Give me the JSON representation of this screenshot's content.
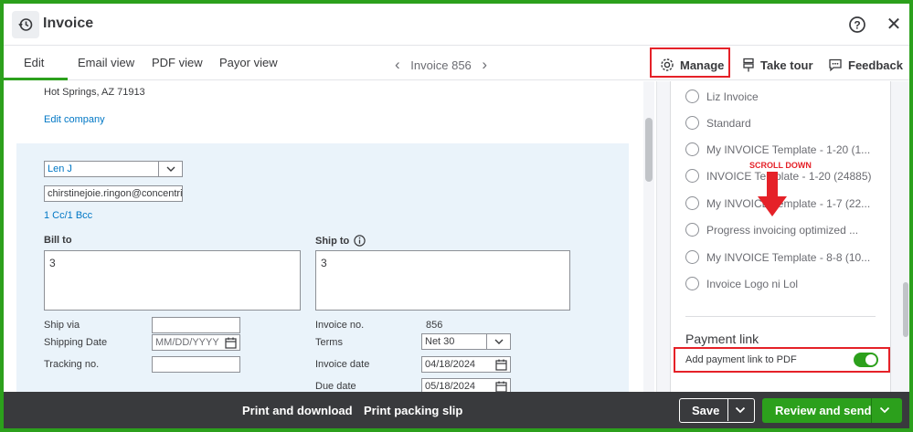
{
  "window": {
    "title": "Invoice"
  },
  "tabs": [
    {
      "label": "Edit"
    },
    {
      "label": "Email view"
    },
    {
      "label": "PDF view"
    },
    {
      "label": "Payor view"
    }
  ],
  "invoice_nav": {
    "label": "Invoice 856",
    "prev": "‹",
    "next": "›"
  },
  "header_actions": {
    "manage": "Manage",
    "take_tour": "Take tour",
    "feedback": "Feedback"
  },
  "company": {
    "address_line": "Hot Springs, AZ 71913",
    "edit_link": "Edit company"
  },
  "customer": {
    "name": "Len J",
    "email": "chirstinejoie.ringon@concentrix.",
    "cc_bcc": "1 Cc/1 Bcc"
  },
  "bill_to": {
    "label": "Bill to",
    "value": "3"
  },
  "ship_to": {
    "label": "Ship to",
    "value": "3"
  },
  "shipping": {
    "ship_via_label": "Ship via",
    "ship_via_value": "",
    "shipping_date_label": "Shipping Date",
    "shipping_date_placeholder": "MM/DD/YYYY",
    "tracking_label": "Tracking no.",
    "tracking_value": ""
  },
  "invoice_meta": {
    "invoice_no_label": "Invoice no.",
    "invoice_no": "856",
    "terms_label": "Terms",
    "terms_value": "Net 30",
    "invoice_date_label": "Invoice date",
    "invoice_date": "04/18/2024",
    "due_date_label": "Due date",
    "due_date": "05/18/2024"
  },
  "templates": [
    {
      "label": "Liz Invoice"
    },
    {
      "label": "Standard"
    },
    {
      "label": "My INVOICE Template - 1-20 (1..."
    },
    {
      "label": "INVOICE Template - 1-20 (24885)"
    },
    {
      "label": "My INVOICE Template - 1-7 (22..."
    },
    {
      "label": "Progress invoicing optimized ..."
    },
    {
      "label": "My INVOICE Template - 8-8 (10..."
    },
    {
      "label": "Invoice Logo ni Lol"
    }
  ],
  "annotation": {
    "scroll_text": "SCROLL DOWN"
  },
  "payment_link": {
    "title": "Payment link",
    "toggle_label": "Add payment link to PDF",
    "enabled": true
  },
  "footer": {
    "print_download": "Print and download",
    "print_packing": "Print packing slip",
    "save": "Save",
    "review_send": "Review and send"
  },
  "colors": {
    "accent_green": "#2ca01c",
    "annotation_red": "#e52128",
    "link_blue": "#0077c5",
    "footer_bg": "#393a3d"
  }
}
